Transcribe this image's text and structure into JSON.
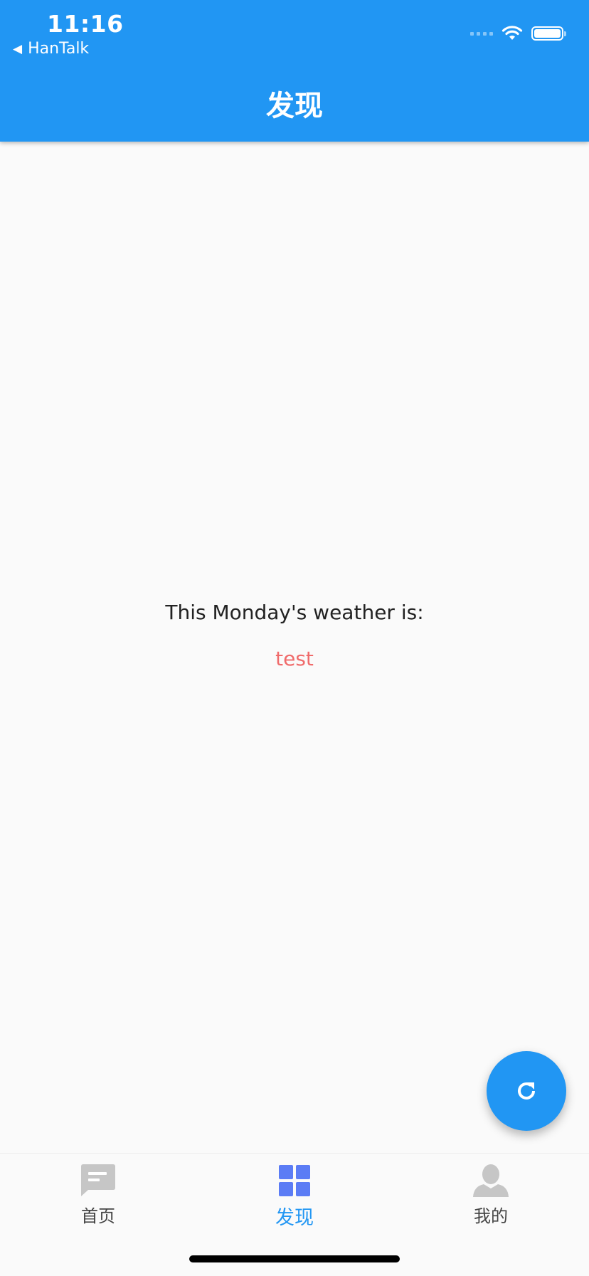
{
  "status_bar": {
    "time": "11:16",
    "back_app": "HanTalk"
  },
  "header": {
    "title": "发现"
  },
  "main": {
    "weather_label": "This Monday's weather is:",
    "weather_value": "test"
  },
  "fab": {
    "icon": "refresh-icon"
  },
  "bottom_nav": {
    "items": [
      {
        "label": "首页",
        "icon": "chat-bubble-icon"
      },
      {
        "label": "发现",
        "icon": "grid-icon"
      },
      {
        "label": "我的",
        "icon": "person-icon"
      }
    ],
    "active_index": 1
  },
  "colors": {
    "primary": "#2196f3",
    "background": "#fafafa",
    "weather_value": "#f06b6b",
    "grid_icon": "#5b7cf5",
    "inactive_icon": "#c6c6c6"
  }
}
